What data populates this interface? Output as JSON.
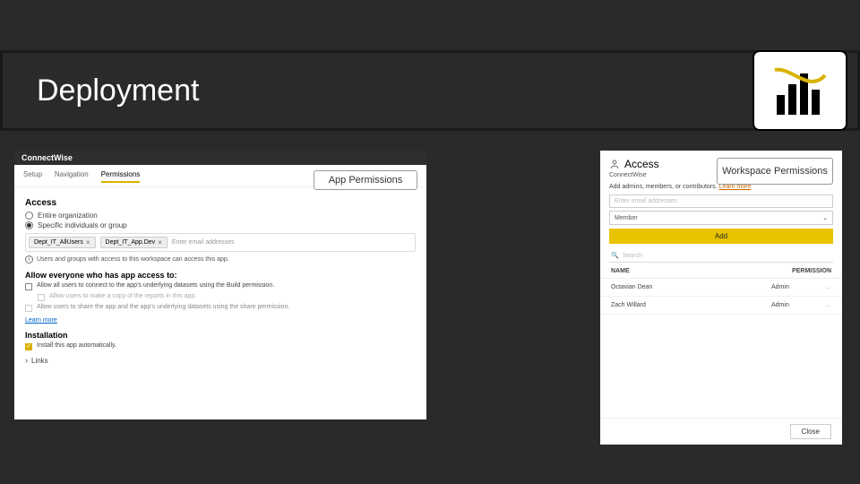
{
  "header": {
    "title": "Deployment"
  },
  "callouts": {
    "left": "App Permissions",
    "right": "Workspace Permissions"
  },
  "left_panel": {
    "titlebar": "ConnectWise",
    "tabs": {
      "setup": "Setup",
      "navigation": "Navigation",
      "permissions": "Permissions"
    },
    "access_heading": "Access",
    "radio_org": "Entire organization",
    "radio_specific": "Specific individuals or group",
    "chips": {
      "a": "Dept_IT_AllUsers",
      "b": "Dept_IT_App.Dev"
    },
    "chip_placeholder": "Enter email addresses",
    "info_text": "Users and groups with access to this workspace can access this app.",
    "allow_heading": "Allow everyone who has app access to:",
    "cb_build": "Allow all users to connect to the app's underlying datasets using the Build permission.",
    "cb_copy": "Allow users to make a copy of the reports in this app.",
    "cb_share": "Allow users to share the app and the app's underlying datasets using the share permission.",
    "learn_more": "Learn more",
    "install_heading": "Installation",
    "cb_install": "Install this app automatically.",
    "links_label": "Links"
  },
  "right_panel": {
    "title": "Access",
    "subtitle": "ConnectWise",
    "desc_prefix": "Add admins, members, or contributors. ",
    "desc_link": "Learn more",
    "email_placeholder": "Enter email addresses",
    "role_value": "Member",
    "add_button": "Add",
    "search_placeholder": "Search",
    "th_name": "NAME",
    "th_perm": "PERMISSION",
    "rows": [
      {
        "name": "Octavian Dean",
        "perm": "Admin"
      },
      {
        "name": "Zach Willard",
        "perm": "Admin"
      }
    ],
    "close": "Close"
  }
}
